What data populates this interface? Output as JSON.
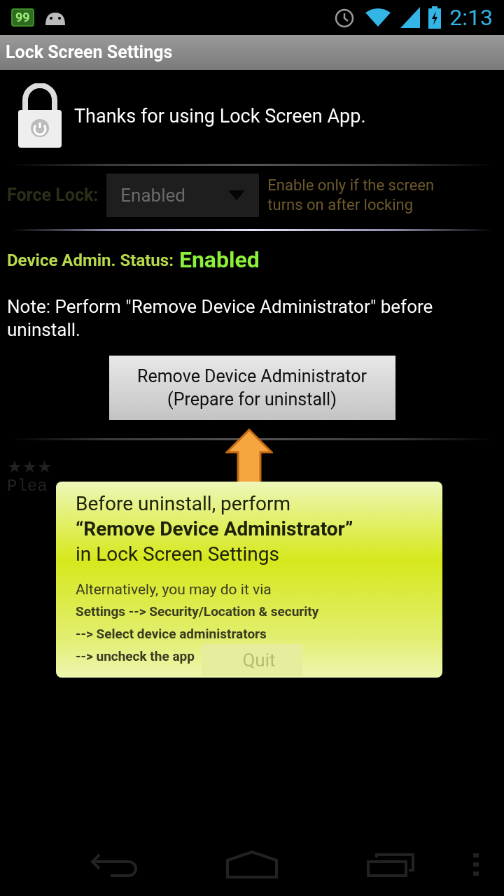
{
  "status_bar": {
    "battery_badge": "99",
    "time": "2:13"
  },
  "title_bar": {
    "title": "Lock Screen Settings"
  },
  "header": {
    "message": "Thanks for using Lock Screen App."
  },
  "force_lock": {
    "label": "Force Lock:",
    "value": "Enabled",
    "hint": "Enable only if the screen turns on after locking",
    "disabled": true
  },
  "admin_status": {
    "label": "Device Admin. Status:",
    "value": "Enabled"
  },
  "note": "Note: Perform \"Remove Device Administrator\" before uninstall.",
  "remove_button": {
    "line_1": "Remove Device Administrator",
    "line_2": "(Prepare for uninstall)"
  },
  "rating_row": {
    "stars_text": "★★★",
    "text": "Plea"
  },
  "quit_button": "Quit",
  "tip": {
    "headline": "Before uninstall, perform\n**“Remove Device Administrator”**\nin Lock Screen Settings",
    "intro": "Alternatively, you may do it via",
    "steps": [
      "Settings --> Security/Location & security",
      "--> Select device administrators",
      "--> uncheck the app"
    ]
  }
}
